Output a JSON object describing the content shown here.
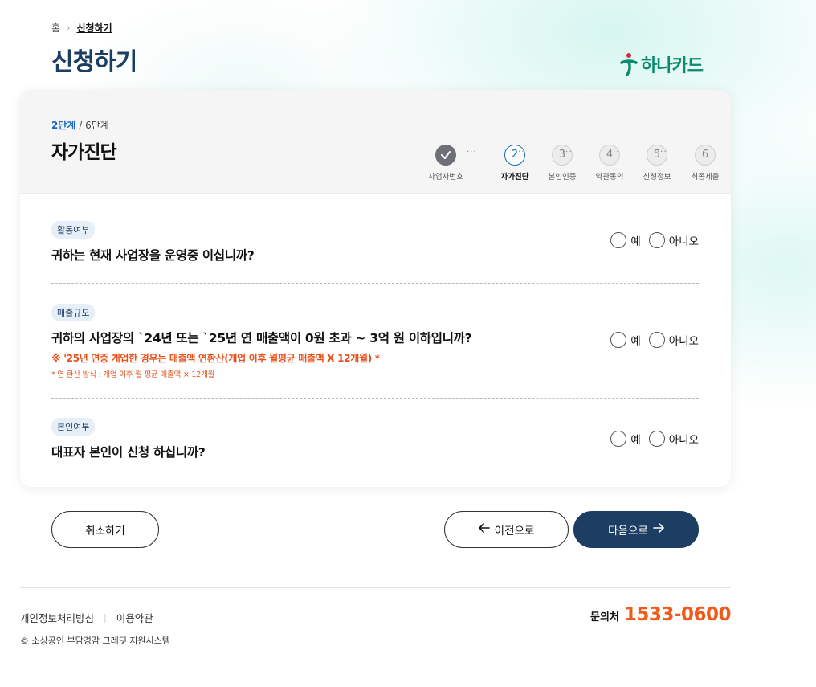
{
  "breadcrumb": {
    "home": "홈",
    "current": "신청하기"
  },
  "page_title": "신청하기",
  "logo": {
    "text": "하나카드"
  },
  "step_header": {
    "current": "2단계",
    "separator": " / ",
    "total": "6단계",
    "title": "자가진단"
  },
  "stepper": [
    {
      "num": "",
      "label": "사업자번호",
      "state": "done"
    },
    {
      "num": "2",
      "label": "자가진단",
      "state": "active"
    },
    {
      "num": "3",
      "label": "본인인증",
      "state": "pending"
    },
    {
      "num": "4",
      "label": "약관동의",
      "state": "pending"
    },
    {
      "num": "5",
      "label": "신청정보",
      "state": "pending"
    },
    {
      "num": "6",
      "label": "최종제출",
      "state": "pending"
    }
  ],
  "questions": [
    {
      "tag": "활동여부",
      "text": "귀하는 현재 사업장을 운영중 이십니까?",
      "yes": "예",
      "no": "아니오"
    },
    {
      "tag": "매출규모",
      "text": "귀하의 사업장의 `24년 또는 `25년 연 매출액이 0원 초과 ~ 3억 원 이하입니까?",
      "note1": "※ '25년 연중 개업한 경우는 매출액 연환산(개업 이후 월평균 매출액 X 12개월) *",
      "note2": "* 연 환산 방식 : 개업 이후 월 평균 매출액 × 12개월",
      "yes": "예",
      "no": "아니오"
    },
    {
      "tag": "본인여부",
      "text": "대표자 본인이 신청 하십니까?",
      "yes": "예",
      "no": "아니오"
    }
  ],
  "buttons": {
    "cancel": "취소하기",
    "prev": "이전으로",
    "next": "다음으로"
  },
  "footer": {
    "privacy": "개인정보처리방침",
    "terms": "이용약관",
    "copyright": "© 소상공인 부담경감 크레딧 지원시스템",
    "contact_label": "문의처",
    "contact_phone": "1533-0600"
  },
  "colors": {
    "primary": "#1d3e63",
    "accent_blue": "#1a6bc1",
    "warning": "#e8501a",
    "phone": "#f25a1a",
    "logo_green": "#0e8a6d"
  }
}
